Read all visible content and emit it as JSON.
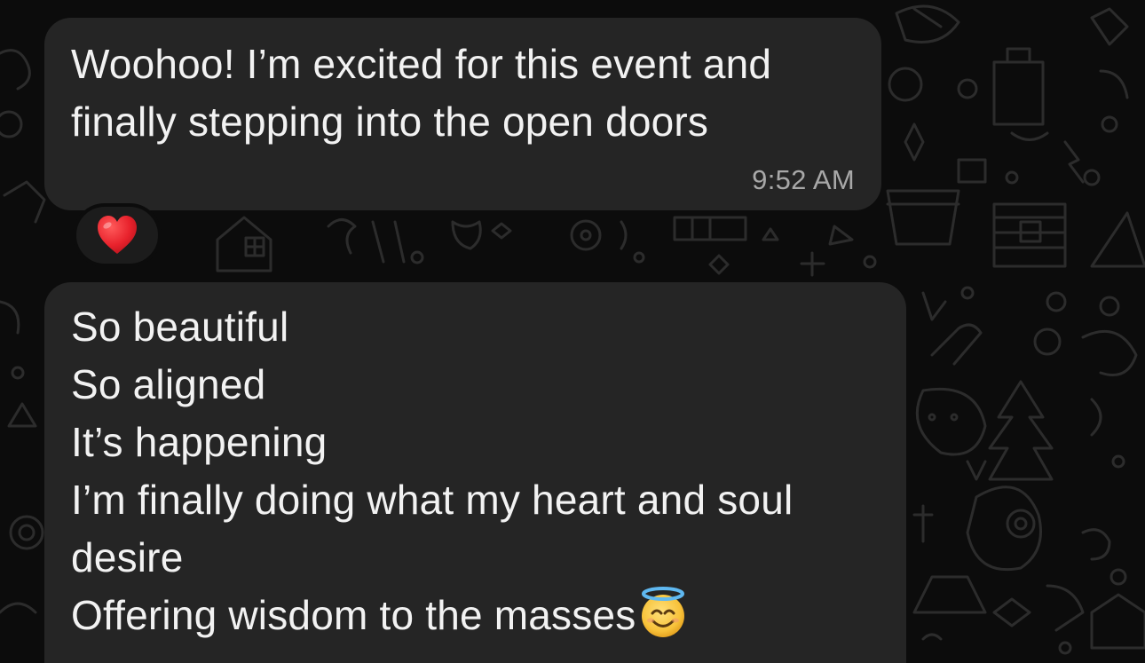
{
  "messages": [
    {
      "lines": [
        "Woohoo! I’m excited for this event and",
        "finally stepping into the open doors"
      ],
      "time": "9:52 AM",
      "reaction": "heart-emoji"
    },
    {
      "lines": [
        "So beautiful",
        "So aligned",
        "It’s happening",
        "I’m finally doing what my heart and soul",
        "desire",
        "Offering wisdom to the masses"
      ],
      "trailing_emoji": "smiling-face-with-halo-emoji"
    }
  ],
  "colors": {
    "background": "#0c0c0c",
    "bubble": "#252525",
    "text": "#f2f2f2",
    "timestamp": "#a8a8a8",
    "heart": "#e8222c",
    "halo_face": "#f7c23a",
    "halo_ring": "#5fb8f0"
  }
}
